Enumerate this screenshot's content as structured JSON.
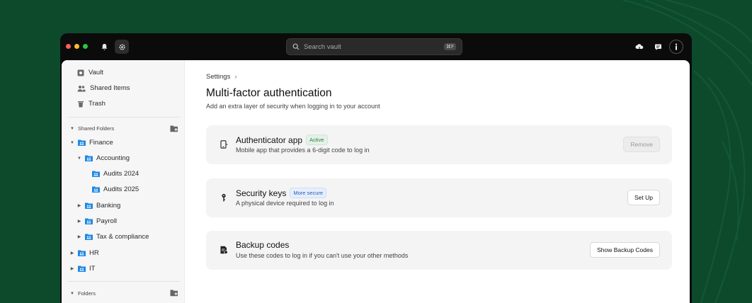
{
  "colors": {
    "background": "#0d4a2c",
    "accent": "#1e88e5",
    "active_badge": "#2f7a45",
    "secure_badge": "#2c5fb8"
  },
  "titlebar": {
    "icons": [
      "bell-icon",
      "gear-icon"
    ],
    "search": {
      "placeholder": "Search vault",
      "shortcut": "⌘F"
    },
    "right_icons": [
      "cloud-sync-icon",
      "chat-icon",
      "info-icon"
    ]
  },
  "sidebar": {
    "items": [
      {
        "label": "Vault",
        "icon": "vault-icon"
      },
      {
        "label": "Shared Items",
        "icon": "people-icon"
      },
      {
        "label": "Trash",
        "icon": "trash-icon"
      }
    ],
    "shared_folders_label": "Shared Folders",
    "folders": [
      {
        "label": "Finance"
      },
      {
        "label": "Accounting"
      },
      {
        "label": "Audits 2024"
      },
      {
        "label": "Audits 2025"
      },
      {
        "label": "Banking"
      },
      {
        "label": "Payroll"
      },
      {
        "label": "Tax & compliance"
      },
      {
        "label": "HR"
      },
      {
        "label": "IT"
      }
    ],
    "folders_label": "Folders"
  },
  "main": {
    "breadcrumb": "Settings",
    "breadcrumb_chevron": "›",
    "title": "Multi-factor authentication",
    "subtitle": "Add an extra layer of security when logging in to your account",
    "methods": [
      {
        "title": "Authenticator app",
        "badge": "Active",
        "description": "Mobile app that provides a 6-digit code to log in",
        "button": "Remove",
        "icon": "phone-icon"
      },
      {
        "title": "Security keys",
        "badge": "More secure",
        "description": "A physical device required to log in",
        "button": "Set Up",
        "icon": "key-icon"
      },
      {
        "title": "Backup codes",
        "description": "Use these codes to log in if you can't use your other methods",
        "button": "Show Backup Codes",
        "icon": "backup-codes-icon"
      }
    ]
  }
}
